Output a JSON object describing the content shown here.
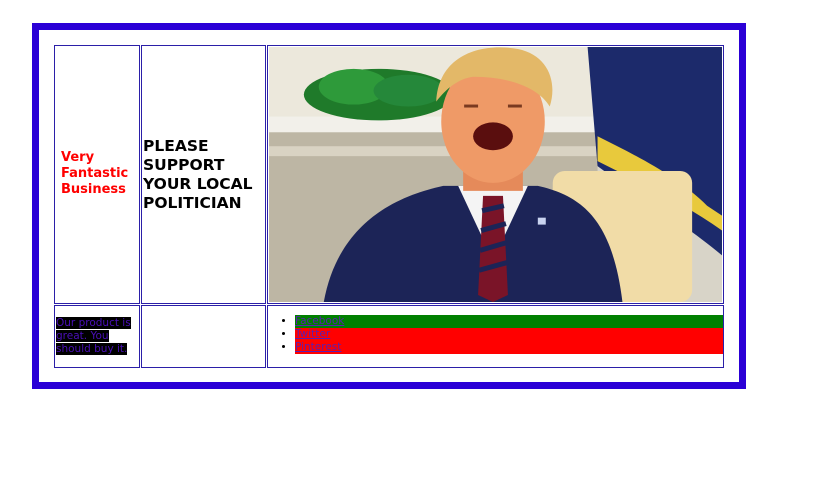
{
  "colors": {
    "frame_border": "#2b00d6",
    "business_text": "#ff0000",
    "facebook_bg": "#008000",
    "twitter_bg": "#ff0000",
    "pinterest_bg": "#ff0000"
  },
  "table": {
    "business_name": "Very Fantastic Business",
    "slogan": "PLEASE SUPPORT YOUR LOCAL POLITICIAN",
    "product_text": "Our product is great. You should buy it.",
    "social_links": [
      {
        "label": "Facebook"
      },
      {
        "label": "Twitter"
      },
      {
        "label": "Pinterest"
      }
    ]
  }
}
